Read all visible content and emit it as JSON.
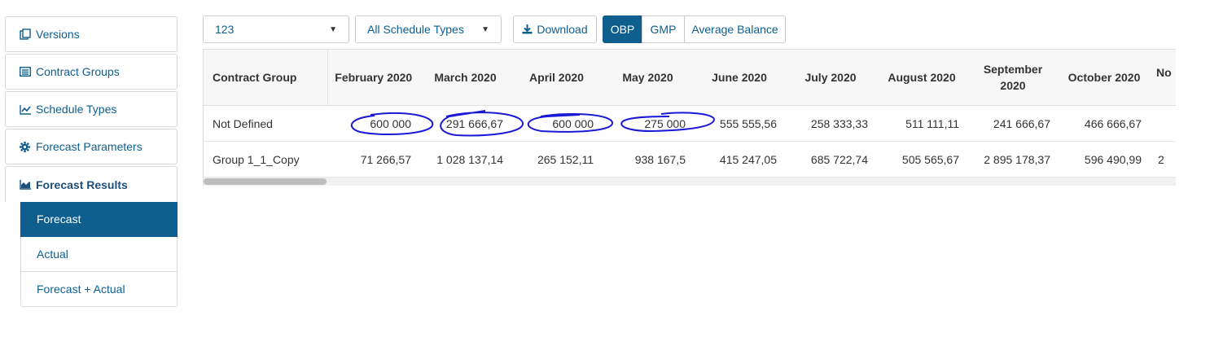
{
  "sidebar": {
    "items": [
      {
        "label": "Versions",
        "icon": "copy-icon"
      },
      {
        "label": "Contract Groups",
        "icon": "list-icon"
      },
      {
        "label": "Schedule Types",
        "icon": "line-chart-icon"
      },
      {
        "label": "Forecast Parameters",
        "icon": "gear-icon"
      },
      {
        "label": "Forecast Results",
        "icon": "area-chart-icon"
      }
    ],
    "subitems": [
      {
        "label": "Forecast"
      },
      {
        "label": "Actual"
      },
      {
        "label": "Forecast + Actual"
      }
    ]
  },
  "toolbar": {
    "version_select": "123",
    "schedule_select": "All Schedule Types",
    "download_label": "Download",
    "obp_label": "OBP",
    "gmp_label": "GMP",
    "avg_label": "Average Balance"
  },
  "table": {
    "headers": [
      "Contract Group",
      "February 2020",
      "March 2020",
      "April 2020",
      "May 2020",
      "June 2020",
      "July 2020",
      "August 2020",
      "September 2020",
      "October 2020",
      "No"
    ],
    "rows": [
      [
        "Not Defined",
        "600 000",
        "291 666,67",
        "600 000",
        "275 000",
        "555 555,56",
        "258 333,33",
        "511 111,11",
        "241 666,67",
        "466 666,67",
        ""
      ],
      [
        "Group 1_1_Copy",
        "71 266,57",
        "1 028 137,14",
        "265 152,11",
        "938 167,5",
        "415 247,05",
        "685 722,74",
        "505 565,67",
        "2 895 178,37",
        "596 490,99",
        "2"
      ]
    ]
  },
  "colors": {
    "accent": "#0f5f8e",
    "annotation": "#1a1ad6"
  }
}
